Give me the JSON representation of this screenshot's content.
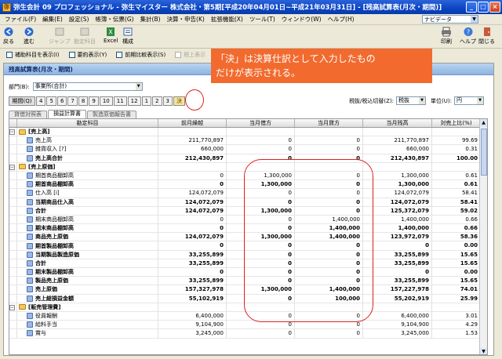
{
  "window": {
    "title": "弥生会計 09 プロフェッショナル - 弥生マイスター 株式会社・第5期[平成20年04月01日~平成21年03月31日] - [残高試算表(月次・期間)]",
    "minimize": "_",
    "maximize": "□",
    "close": "×"
  },
  "menu": {
    "items": [
      "ファイル(F)",
      "編集(E)",
      "設定(S)",
      "帳簿・伝票(G)",
      "集計(B)",
      "決算・申告(K)",
      "拡張機能(X)",
      "ツール(T)",
      "ウィンドウ(W)",
      "ヘルプ(H)"
    ],
    "navidata": "ナビデータ"
  },
  "toolbar": {
    "back": "戻る",
    "forward": "進む",
    "jump": "ジャンプ",
    "account_add": "勘定科目",
    "excel": "Excel",
    "compose": "構成",
    "print": "印刷",
    "help": "ヘルプ",
    "close": "閉じる"
  },
  "options": {
    "sub_accounts": "補助科目を表示(I)",
    "summary": "要約表示(Y)",
    "prev_compare": "前期比較表示(S)",
    "more": "税上表示"
  },
  "panel": {
    "title": "残高試算表(月次・期間)",
    "dept_label": "部門(B):",
    "dept_value": "事業所(合計)",
    "period_label": "期間(Q)",
    "periods": [
      "4",
      "5",
      "6",
      "7",
      "8",
      "9",
      "10",
      "11",
      "12",
      "1",
      "2",
      "3",
      "決"
    ],
    "tax_label": "税抜/税込切替(Z):",
    "tax_value": "税抜",
    "unit_label": "単位(U):",
    "unit_value": "円"
  },
  "tabs": [
    "貸借対照表",
    "損益計算書",
    "製造原価報告書"
  ],
  "columns": {
    "account": "勘定科目",
    "prev": "前月繰越",
    "debit": "当月借方",
    "credit": "当月貸方",
    "balance": "当月残高",
    "ratio": "対売上比(%)"
  },
  "rows": [
    {
      "level": 0,
      "expander": "−",
      "type": "folder",
      "name": "[売上高]",
      "prev": "",
      "debit": "",
      "credit": "",
      "balance": "",
      "ratio": "",
      "bold": true,
      "num": ""
    },
    {
      "level": 1,
      "expander": "",
      "type": "item",
      "name": "売上高",
      "prev": "211,770,897",
      "debit": "0",
      "credit": "0",
      "balance": "211,770,897",
      "ratio": "99.69",
      "bold": false,
      "num": ""
    },
    {
      "level": 1,
      "expander": "",
      "type": "item",
      "name": "雑貨収入 [?]",
      "prev": "660,000",
      "debit": "0",
      "credit": "0",
      "balance": "660,000",
      "ratio": "0.31",
      "bold": false,
      "num": ""
    },
    {
      "level": 1,
      "expander": "",
      "type": "item",
      "name": "売上高合計",
      "prev": "212,430,897",
      "debit": "0",
      "credit": "0",
      "balance": "212,430,897",
      "ratio": "100.00",
      "bold": true,
      "num": ""
    },
    {
      "level": 0,
      "expander": "−",
      "type": "folder",
      "name": "[売上原価]",
      "prev": "",
      "debit": "",
      "credit": "",
      "balance": "",
      "ratio": "",
      "bold": true,
      "num": ""
    },
    {
      "level": 1,
      "expander": "",
      "type": "item",
      "name": "期首商品棚卸高",
      "prev": "0",
      "debit": "1,300,000",
      "credit": "0",
      "balance": "1,300,000",
      "ratio": "0.61",
      "bold": false,
      "num": ""
    },
    {
      "level": 1,
      "expander": "",
      "type": "item",
      "name": "期首商品棚卸高",
      "prev": "0",
      "debit": "1,300,000",
      "credit": "0",
      "balance": "1,300,000",
      "ratio": "0.61",
      "bold": true,
      "num": ""
    },
    {
      "level": 1,
      "expander": "",
      "type": "item",
      "name": "仕入高 [i]",
      "prev": "124,072,079",
      "debit": "0",
      "credit": "0",
      "balance": "124,072,079",
      "ratio": "58.41",
      "bold": false,
      "num": ""
    },
    {
      "level": 1,
      "expander": "",
      "type": "item",
      "name": "当期商品仕入高",
      "prev": "124,072,079",
      "debit": "0",
      "credit": "0",
      "balance": "124,072,079",
      "ratio": "58.41",
      "bold": true,
      "num": ""
    },
    {
      "level": 1,
      "expander": "",
      "type": "item",
      "name": "合計",
      "prev": "124,072,079",
      "debit": "1,300,000",
      "credit": "0",
      "balance": "125,372,079",
      "ratio": "59.02",
      "bold": true,
      "num": ""
    },
    {
      "level": 1,
      "expander": "",
      "type": "item",
      "name": "期末商品棚卸高",
      "prev": "0",
      "debit": "0",
      "credit": "1,400,000",
      "balance": "1,400,000",
      "ratio": "0.66",
      "bold": false,
      "num": ""
    },
    {
      "level": 1,
      "expander": "",
      "type": "item",
      "name": "期末商品棚卸高",
      "prev": "0",
      "debit": "0",
      "credit": "1,400,000",
      "balance": "1,400,000",
      "ratio": "0.66",
      "bold": true,
      "num": ""
    },
    {
      "level": 1,
      "expander": "",
      "type": "item",
      "name": "商品売上原価",
      "prev": "124,072,079",
      "debit": "1,300,000",
      "credit": "1,400,000",
      "balance": "123,972,079",
      "ratio": "58.36",
      "bold": true,
      "num": ""
    },
    {
      "level": 1,
      "expander": "",
      "type": "item",
      "name": "期首製品棚卸高",
      "prev": "0",
      "debit": "0",
      "credit": "0",
      "balance": "0",
      "ratio": "0.00",
      "bold": true,
      "num": ""
    },
    {
      "level": 1,
      "expander": "",
      "type": "item",
      "name": "当期製品製造原価",
      "prev": "33,255,899",
      "debit": "0",
      "credit": "0",
      "balance": "33,255,899",
      "ratio": "15.65",
      "bold": true,
      "num": ""
    },
    {
      "level": 1,
      "expander": "",
      "type": "item",
      "name": "合計",
      "prev": "33,255,899",
      "debit": "0",
      "credit": "0",
      "balance": "33,255,899",
      "ratio": "15.65",
      "bold": true,
      "num": ""
    },
    {
      "level": 1,
      "expander": "",
      "type": "item",
      "name": "期末製品棚卸高",
      "prev": "0",
      "debit": "0",
      "credit": "0",
      "balance": "0",
      "ratio": "0.00",
      "bold": true,
      "num": ""
    },
    {
      "level": 1,
      "expander": "",
      "type": "item",
      "name": "製品売上原価",
      "prev": "33,255,899",
      "debit": "0",
      "credit": "0",
      "balance": "33,255,899",
      "ratio": "15.65",
      "bold": true,
      "num": ""
    },
    {
      "level": 1,
      "expander": "",
      "type": "item",
      "name": "売上原価",
      "prev": "157,327,978",
      "debit": "1,300,000",
      "credit": "1,400,000",
      "balance": "157,227,978",
      "ratio": "74.01",
      "bold": true,
      "num": ""
    },
    {
      "level": 1,
      "expander": "",
      "type": "item",
      "name": "売上総損益金額",
      "prev": "55,102,919",
      "debit": "0",
      "credit": "100,000",
      "balance": "55,202,919",
      "ratio": "25.99",
      "bold": true,
      "num": ""
    },
    {
      "level": 0,
      "expander": "−",
      "type": "folder",
      "name": "[販売管理費]",
      "prev": "",
      "debit": "",
      "credit": "",
      "balance": "",
      "ratio": "",
      "bold": true,
      "num": ""
    },
    {
      "level": 1,
      "expander": "",
      "type": "item",
      "name": "役員報酬",
      "prev": "6,400,000",
      "debit": "0",
      "credit": "0",
      "balance": "6,400,000",
      "ratio": "3.01",
      "bold": false,
      "num": ""
    },
    {
      "level": 1,
      "expander": "",
      "type": "item",
      "name": "給料手当",
      "prev": "9,104,900",
      "debit": "0",
      "credit": "0",
      "balance": "9,104,900",
      "ratio": "4.29",
      "bold": false,
      "num": ""
    },
    {
      "level": 1,
      "expander": "",
      "type": "item",
      "name": "賞与",
      "prev": "3,245,000",
      "debit": "0",
      "credit": "0",
      "balance": "3,245,000",
      "ratio": "1.53",
      "bold": false,
      "num": ""
    }
  ],
  "callout": {
    "line1": "「決」は決算仕訳として入力したもの",
    "line2": "だけが表示される。"
  }
}
